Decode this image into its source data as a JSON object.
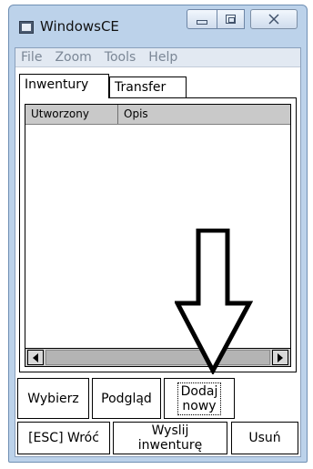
{
  "window": {
    "title": "WindowsCE"
  },
  "menubar": {
    "items": [
      "File",
      "Zoom",
      "Tools",
      "Help"
    ]
  },
  "tabs": [
    {
      "label": "Inwentury",
      "active": true
    },
    {
      "label": "Transfer",
      "active": false
    }
  ],
  "list": {
    "columns": [
      "Utworzony",
      "Opis"
    ],
    "rows": []
  },
  "buttons": {
    "wybierz": "Wybierz",
    "podglad": "Podgląd",
    "dodaj": "Dodaj\nnowy",
    "wroc": "[ESC] Wróć",
    "wyslij": "Wyslij\ninwenturę",
    "usun": "Usuń"
  },
  "icons": {
    "app": "windows-ce-app-icon",
    "minimize": "minimize-icon",
    "maximize": "maximize-icon",
    "close": "close-icon",
    "scroll_left": "arrow-left-icon",
    "scroll_right": "arrow-right-icon",
    "annotation": "down-arrow-annotation"
  },
  "colors": {
    "titlebar": "#bcd2ea",
    "menu_text": "#7b8796",
    "header_bg": "#c9c9c9"
  }
}
